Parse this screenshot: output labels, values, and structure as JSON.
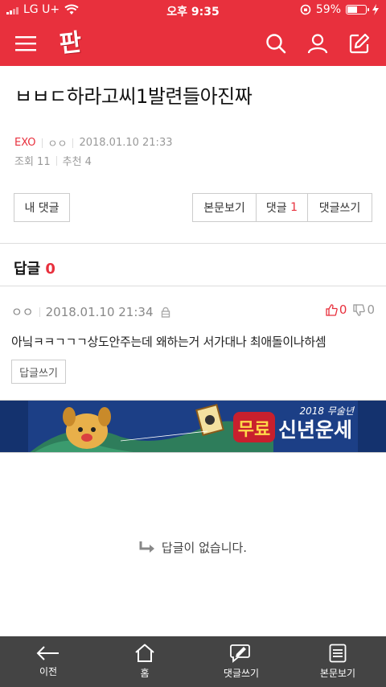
{
  "status_bar": {
    "carrier": "LG U+",
    "time": "오후 9:35",
    "battery_pct_label": "59%",
    "battery_level": 0.59
  },
  "colors": {
    "brand_red": "#e8303d",
    "bottom_bar": "#444444",
    "banner_bg": "#14326e"
  },
  "header": {
    "logo_text": "판",
    "icons": [
      "menu-icon",
      "search-icon",
      "user-icon",
      "edit-icon"
    ]
  },
  "post": {
    "title": "ㅂㅂㄷ하라고씨1발련들아진짜",
    "category": "EXO",
    "author": "ㅇㅇ",
    "datetime": "2018.01.10 21:33",
    "views_label": "조회 11",
    "recommend_label": "추천 4"
  },
  "actions": {
    "my_comments": "내 댓글",
    "view_body": "본문보기",
    "comments_label": "댓글",
    "comments_count": "1",
    "write_comment": "댓글쓰기"
  },
  "replies": {
    "label": "답글",
    "count": "0"
  },
  "comment": {
    "author": "ㅇㅇ",
    "datetime": "2018.01.10 21:34",
    "likes": "0",
    "dislikes": "0",
    "text": "아닠ㅋㅋㄱㄱㄱ상도안주는데 왜하는거 서가대나 최애돌이나하셈",
    "reply_button": "답글쓰기"
  },
  "banner": {
    "year_text": "2018 무술년",
    "free_text": "무료",
    "fortune_text": "신년운세"
  },
  "empty_message": "답글이 없습니다.",
  "bottom_nav": {
    "prev": "이전",
    "home": "홈",
    "write_comment": "댓글쓰기",
    "view_body": "본문보기"
  }
}
